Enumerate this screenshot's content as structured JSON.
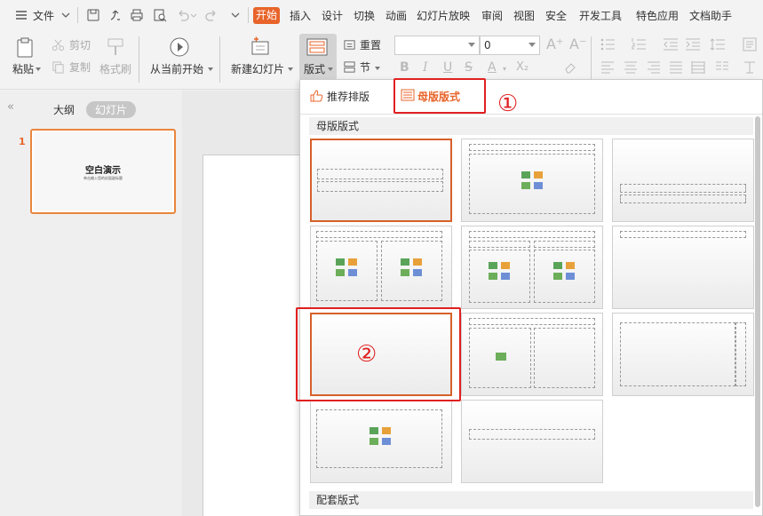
{
  "menubar": {
    "file": "文件",
    "tabs": [
      "开始",
      "插入",
      "设计",
      "切换",
      "动画",
      "幻灯片放映",
      "审阅",
      "视图",
      "安全",
      "开发工具",
      "特色应用",
      "文档助手"
    ]
  },
  "ribbon": {
    "paste": "粘贴",
    "cut": "剪切",
    "copy": "复制",
    "format_painter": "格式刷",
    "play_from_current": "从当前开始",
    "new_slide": "新建幻灯片",
    "layout": "版式",
    "reset": "重置",
    "section": "节",
    "font_name": "",
    "font_size": "0"
  },
  "left_panel": {
    "tab_outline": "大纲",
    "tab_slides": "幻灯片",
    "slide_number": "1",
    "slide_title": "空白演示",
    "slide_subtitle": "单击输入您的封面副标题"
  },
  "layout_panel": {
    "tab_recommended": "推荐排版",
    "tab_master": "母版版式",
    "section_master": "母版版式",
    "section_matching": "配套版式"
  },
  "annotations": {
    "marker1": "①",
    "marker2": "②"
  },
  "colors": {
    "accent": "#e8642a",
    "annotation_red": "#e02020",
    "selection_orange": "#d6602a"
  }
}
